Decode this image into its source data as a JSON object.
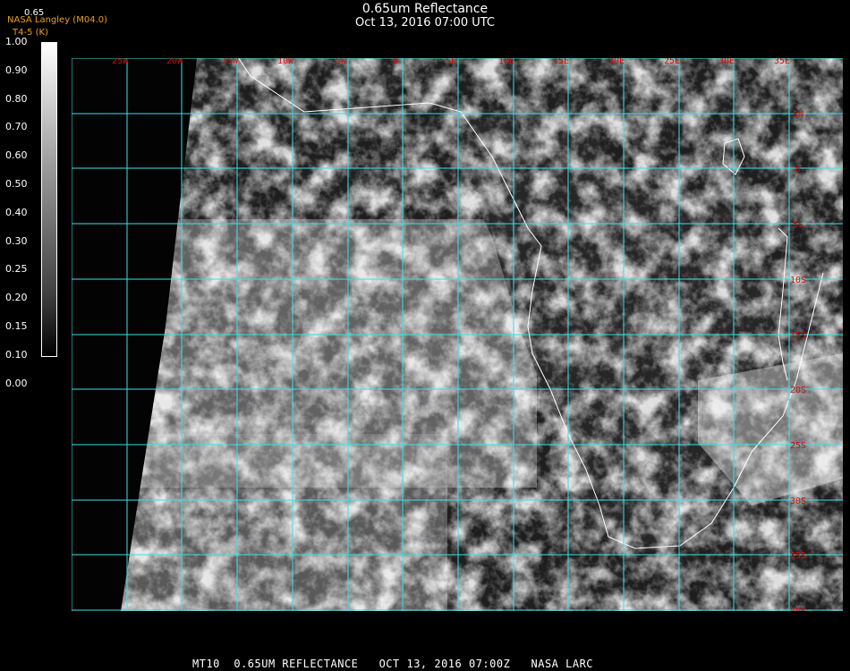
{
  "header": {
    "title": "0.65um Reflectance",
    "subtitle": "Oct 13, 2016 07:00 UTC"
  },
  "credits": {
    "line1": "NASA Langley (M04.0)",
    "line2": "T4-5 (K)"
  },
  "colorbar": {
    "title": "0.65",
    "labels": [
      "1.00",
      "0.90",
      "0.80",
      "0.70",
      "0.60",
      "0.50",
      "0.40",
      "0.30",
      "0.25",
      "0.20",
      "0.15",
      "0.10",
      "0.00"
    ]
  },
  "map": {
    "longitude_labels": [
      "25W",
      "20W",
      "15W",
      "10W",
      "5W",
      "0",
      "5E",
      "10E",
      "15E",
      "20E",
      "25E",
      "30E",
      "35E"
    ],
    "latitude_labels": [
      "5N",
      "0",
      "5S",
      "10S",
      "15S",
      "20S",
      "25S",
      "30S",
      "35S",
      "40S"
    ],
    "colors": {
      "grid": "#38e0e8",
      "tick_label": "#d01010",
      "coastline": "#ffffff"
    }
  },
  "footer": {
    "text": "MT10  0.65UM REFLECTANCE   OCT 13, 2016 07:00Z   NASA LARC"
  }
}
